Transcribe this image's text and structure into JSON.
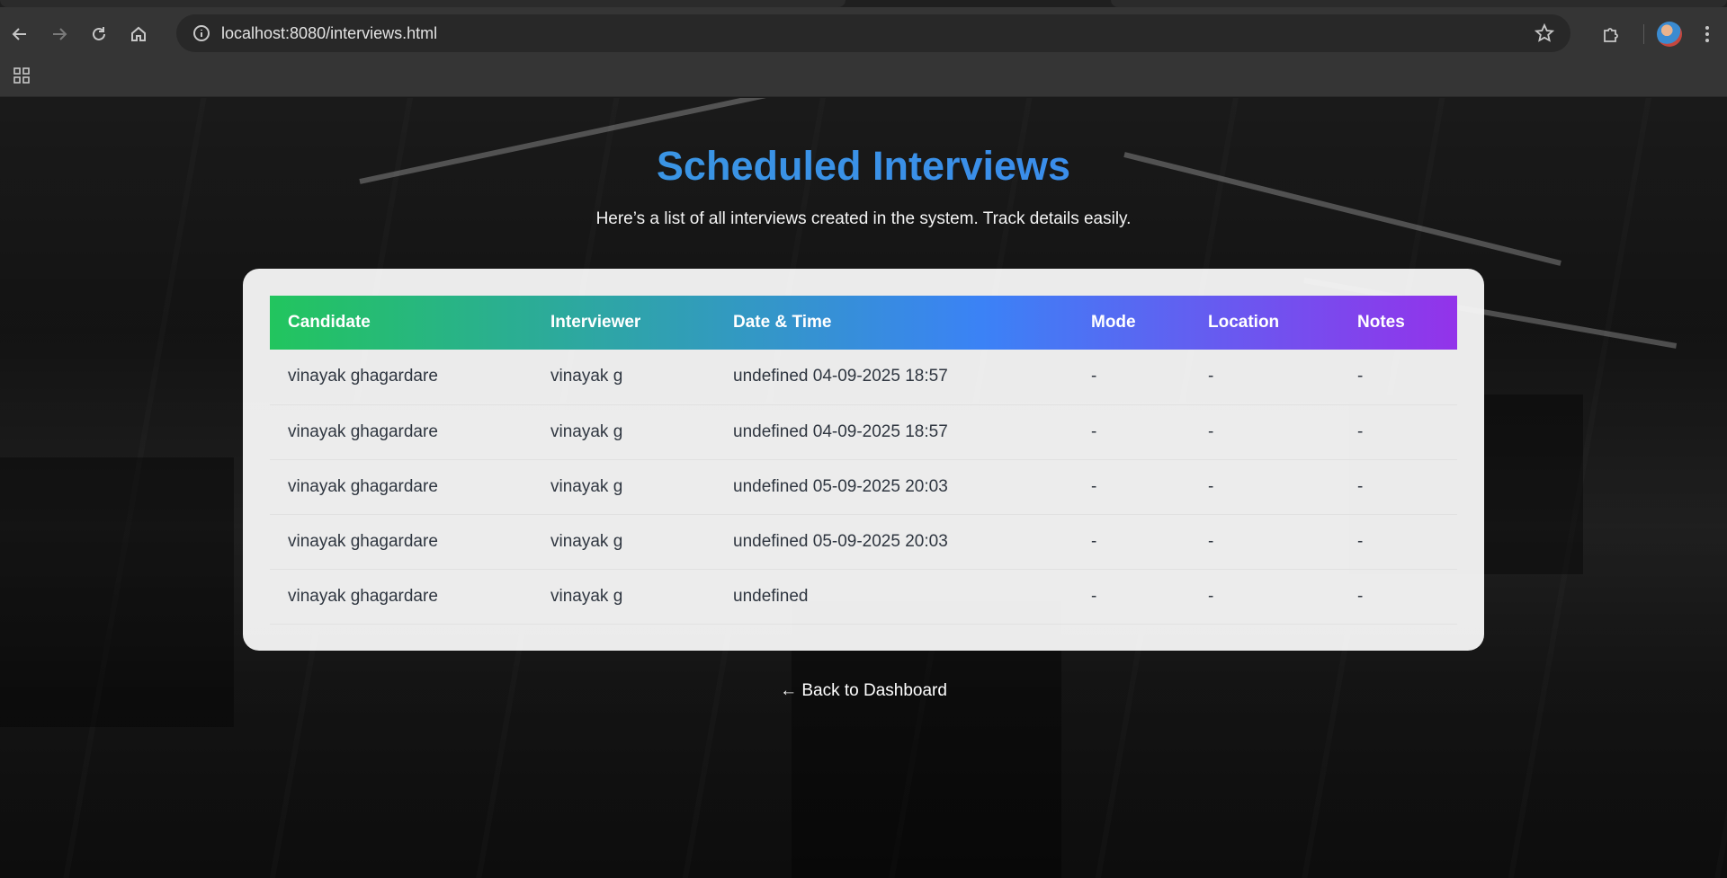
{
  "browser": {
    "url": "localhost:8080/interviews.html"
  },
  "page": {
    "title": "Scheduled Interviews",
    "subtitle": "Here’s a list of all interviews created in the system. Track details easily.",
    "back_link": "← Back to Dashboard"
  },
  "table": {
    "headers": [
      "Candidate",
      "Interviewer",
      "Date & Time",
      "Mode",
      "Location",
      "Notes"
    ],
    "rows": [
      [
        "vinayak ghagardare",
        "vinayak g",
        "undefined 04-09-2025 18:57",
        "-",
        "-",
        "-"
      ],
      [
        "vinayak ghagardare",
        "vinayak g",
        "undefined 04-09-2025 18:57",
        "-",
        "-",
        "-"
      ],
      [
        "vinayak ghagardare",
        "vinayak g",
        "undefined 05-09-2025 20:03",
        "-",
        "-",
        "-"
      ],
      [
        "vinayak ghagardare",
        "vinayak g",
        "undefined 05-09-2025 20:03",
        "-",
        "-",
        "-"
      ],
      [
        "vinayak ghagardare",
        "vinayak g",
        "undefined",
        "-",
        "-",
        "-"
      ]
    ]
  },
  "colors": {
    "header_gradient": [
      "#22c55e",
      "#3b82f6",
      "#9333ea"
    ],
    "title_gradient": [
      "#3aa0d8",
      "#3b82f6"
    ]
  },
  "icons": [
    "back-arrow-icon",
    "forward-arrow-icon",
    "reload-icon",
    "home-icon",
    "info-icon",
    "bookmark-star-icon",
    "extensions-icon",
    "profile-avatar",
    "kebab-menu-icon",
    "apps-grid-icon"
  ]
}
